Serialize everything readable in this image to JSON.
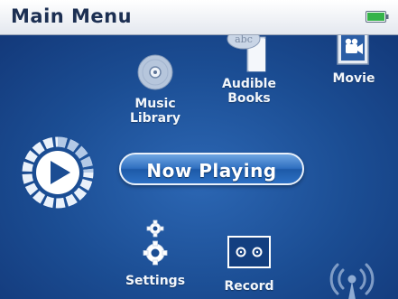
{
  "header": {
    "title": "Main Menu"
  },
  "battery": {
    "icon": "battery-icon",
    "color": "#35b34a"
  },
  "menu": {
    "music_library": {
      "line1": "Music",
      "line2": "Library",
      "icon": "disc-icon"
    },
    "audible_books": {
      "line1": "Audible",
      "line2": "Books",
      "icon": "book-icon",
      "badge": "abc"
    },
    "movie": {
      "label": "Movie",
      "icon": "movie-camera-icon"
    },
    "now_playing": {
      "label": "Now Playing",
      "icon": "play-icon"
    },
    "settings": {
      "label": "Settings",
      "icon": "gear-icon"
    },
    "record": {
      "label": "Record",
      "icon": "cassette-icon"
    },
    "radio": {
      "icon": "radio-antenna-icon"
    }
  },
  "colors": {
    "background": "#1b4d93",
    "header": "#ffffff",
    "title": "#1c2f52",
    "accent": "#2f6fc0"
  }
}
